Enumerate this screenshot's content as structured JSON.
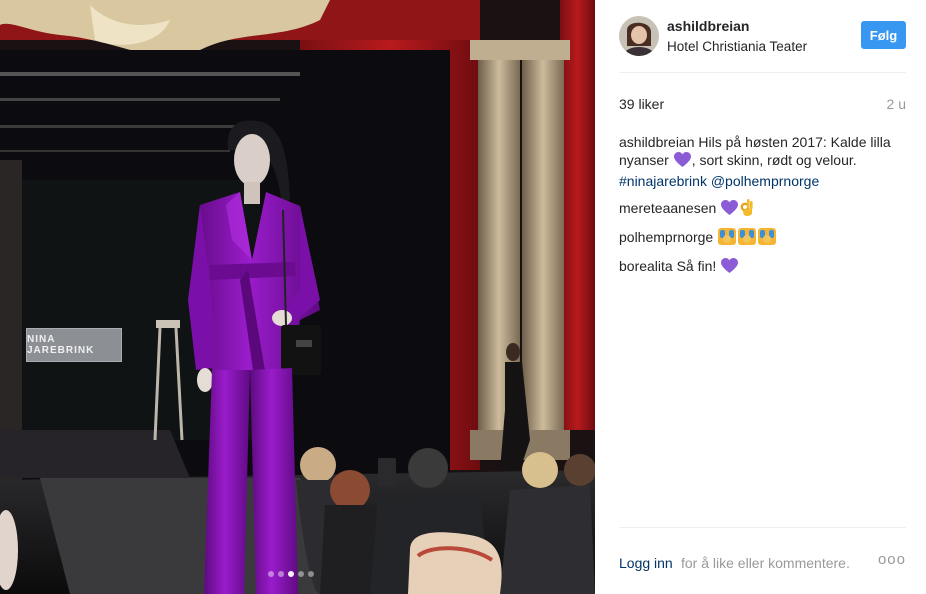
{
  "post": {
    "username": "ashildbreian",
    "location": "Hotel Christiania Teater",
    "follow_label": "Følg",
    "likes": "39 liker",
    "time_ago": "2 u"
  },
  "photo": {
    "stage_sign": "NINA JAREBRINK",
    "carousel_total": 5,
    "carousel_active": 3
  },
  "comments": [
    {
      "username": "ashildbreian",
      "text_1": "Hils på høsten 2017: Kalde lilla nyanser",
      "text_2": ", sort skinn, rødt og velour.",
      "tag_1": "#ninajarebrink",
      "tag_2": "@polhemprnorge"
    },
    {
      "username": "mereteaanesen"
    },
    {
      "username": "polhemprnorge"
    },
    {
      "username": "borealita",
      "text": "Så fin!"
    }
  ],
  "footer": {
    "login_label": "Logg inn",
    "login_rest": "for å like eller kommentere.",
    "more_label": "ooo"
  },
  "icons": {
    "avatar": "user-avatar",
    "heart": "purple-heart-emoji",
    "ok_hand": "ok-hand-emoji",
    "raised_hands": "raised-hands-emoji"
  },
  "colors": {
    "follow_button": "#3897f0",
    "link": "#003569",
    "muted": "#999999",
    "purple_suit": "#8e16b5"
  }
}
